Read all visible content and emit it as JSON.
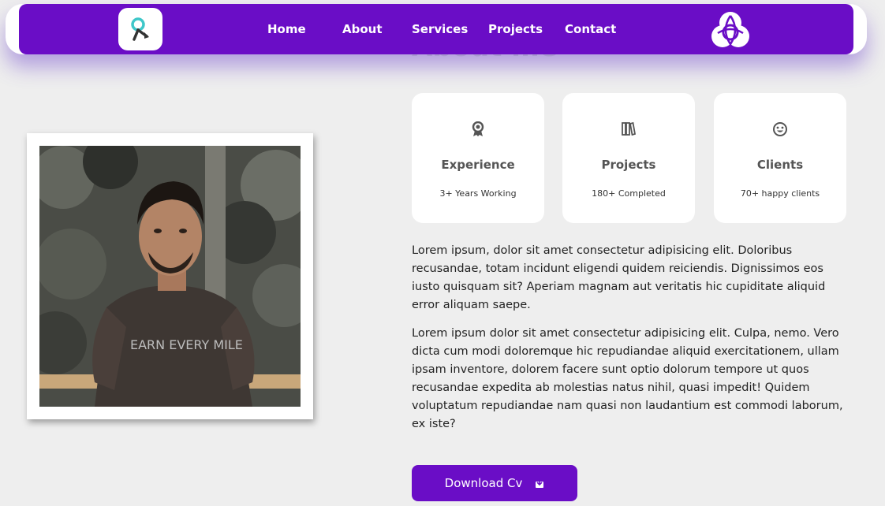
{
  "nav": {
    "logo_icon": "rocket-logo-icon",
    "links": [
      "Home",
      "About",
      "Services",
      "Projects",
      "Contact"
    ],
    "right_icon": "triquetra-logo-icon",
    "accent_color": "#6a0dc6"
  },
  "section": {
    "title": "About me"
  },
  "photo": {
    "shirt_text": "EARN EVERY MILE"
  },
  "cards": [
    {
      "icon": "award-icon",
      "title": "Experience",
      "subtitle": "3+ Years Working"
    },
    {
      "icon": "books-icon",
      "title": "Projects",
      "subtitle": "180+ Completed"
    },
    {
      "icon": "smile-icon",
      "title": "Clients",
      "subtitle": "70+ happy clients"
    }
  ],
  "paragraphs": [
    "Lorem ipsum, dolor sit amet consectetur adipisicing elit. Doloribus recusandae, totam incidunt eligendi quidem reiciendis. Dignissimos eos iusto quisquam sit? Aperiam magnam aut veritatis hic cupiditate aliquid error aliquam saepe.",
    "Lorem ipsum dolor sit amet consectetur adipisicing elit. Culpa, nemo. Vero dicta cum modi doloremque hic repudiandae aliquid exercitationem, ullam ipsam inventore, dolorem facere sunt optio dolorum tempore ut quos recusandae expedita ab molestias natus nihil, quasi impedit! Quidem voluptatum repudiandae nam quasi non laudantium est commodi laborum, ex iste?"
  ],
  "download_button": {
    "label": "Download Cv",
    "icon": "download-icon"
  }
}
